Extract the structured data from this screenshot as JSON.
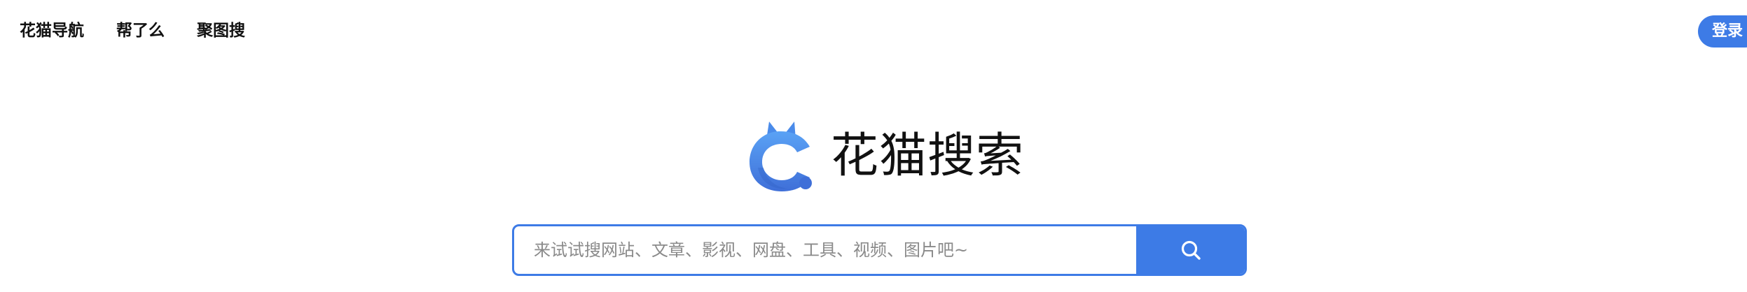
{
  "nav": {
    "items": [
      {
        "label": "花猫导航"
      },
      {
        "label": "帮了么"
      },
      {
        "label": "聚图搜"
      }
    ],
    "login_label": "登录"
  },
  "logo": {
    "text": "花猫搜索",
    "mark_icon": "cat-head-logo-icon"
  },
  "search": {
    "placeholder": "来试试搜网站、文章、影视、网盘、工具、视频、图片吧~",
    "value": "",
    "button_icon": "search-icon"
  },
  "colors": {
    "accent": "#3d7be6",
    "logo_light": "#5aa2f5",
    "logo_dark": "#3f6fd8",
    "text": "#111111",
    "placeholder": "#8a8a8a"
  }
}
